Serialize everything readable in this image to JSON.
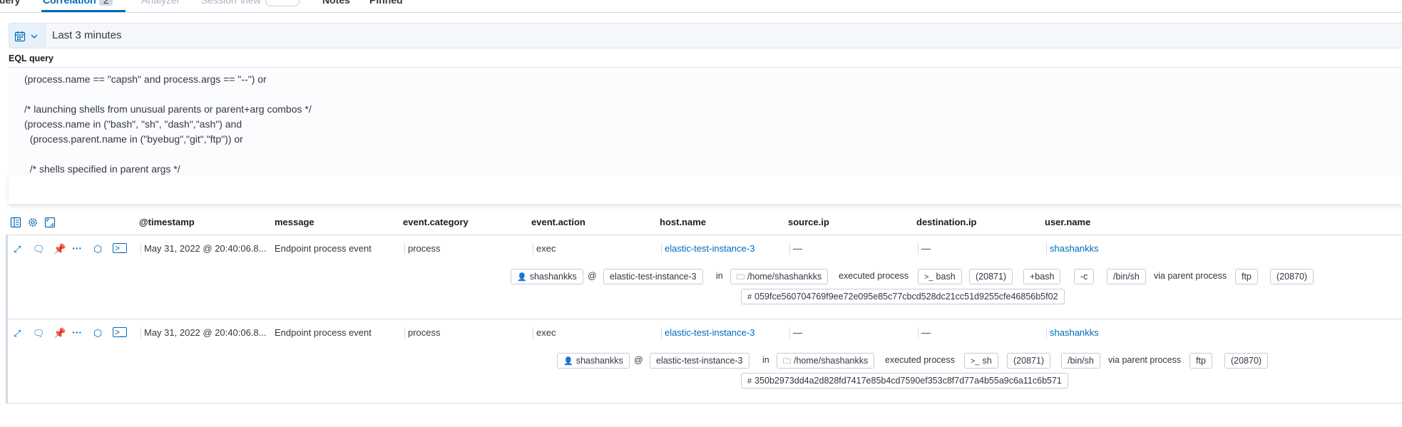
{
  "tabs": {
    "query": "Query",
    "correlation": "Correlation",
    "correlation_badge": "2",
    "analyzer": "Analyzer",
    "session_view": "Session View",
    "notes": "Notes",
    "pinned": "Pinned"
  },
  "date_picker": {
    "value": "Last 3 minutes",
    "icon": "calendar-icon"
  },
  "eql": {
    "label": "EQL query",
    "lines": [
      "(process.name == \"capsh\" and process.args == \"--\") or",
      "/* launching shells from unusual parents or parent+arg combos */",
      "(process.name in (\"bash\", \"sh\", \"dash\",\"ash\") and",
      "  (process.parent.name in (\"byebug\",\"git\",\"ftp\")) or",
      "  /* shells specified in parent args */"
    ]
  },
  "table": {
    "columns": [
      "@timestamp",
      "message",
      "event.category",
      "event.action",
      "host.name",
      "source.ip",
      "destination.ip",
      "user.name"
    ],
    "rows": [
      {
        "timestamp": "May 31, 2022 @ 20:40:06.8...",
        "message": "Endpoint process event",
        "category": "process",
        "action": "exec",
        "host": "elastic-test-instance-3",
        "source_ip": "—",
        "destination_ip": "—",
        "user": "shashankks",
        "detail": {
          "user": "shashankks",
          "at": "@",
          "host": "elastic-test-instance-3",
          "in": "in",
          "dir": "/home/shashankks",
          "executed": "executed process",
          "process": "bash",
          "pid": "(20871)",
          "args": [
            "+bash",
            "-c",
            "/bin/sh"
          ],
          "via": "via parent process",
          "parent": "ftp",
          "parent_pid": "(20870)",
          "hash": "059fce560704769f9ee72e095e85c77cbcd528dc21cc51d9255cfe46856b5f02"
        }
      },
      {
        "timestamp": "May 31, 2022 @ 20:40:06.8...",
        "message": "Endpoint process event",
        "category": "process",
        "action": "exec",
        "host": "elastic-test-instance-3",
        "source_ip": "—",
        "destination_ip": "—",
        "user": "shashankks",
        "detail": {
          "user": "shashankks",
          "at": "@",
          "host": "elastic-test-instance-3",
          "in": "in",
          "dir": "/home/shashankks",
          "executed": "executed process",
          "process": "sh",
          "pid": "(20871)",
          "args": [
            "/bin/sh"
          ],
          "via": "via parent process",
          "parent": "ftp",
          "parent_pid": "(20870)",
          "hash": "350b2973dd4a2d828fd7417e85b4cd7590ef353c8f7d77a4b55a9c6a11c6b571"
        }
      }
    ]
  }
}
